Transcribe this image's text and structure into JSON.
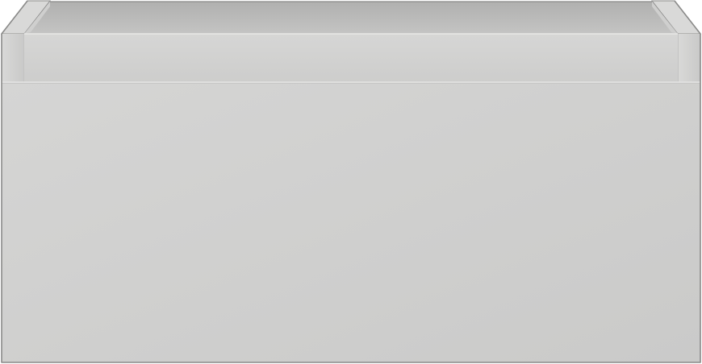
{
  "scene": {
    "subject": "drawer-unit",
    "colors": {
      "background": "#ffffff",
      "front_panel": "#cfcfce",
      "front_panel_light": "#d6d6d5",
      "inner_back": "#bdbdbc",
      "inner_back_top": "#b3b3b2",
      "rim": "#d3d3d2",
      "rim_shadow": "#c2c2c1",
      "edge_line": "#e6e6e5",
      "outline": "#8a8a89"
    }
  }
}
